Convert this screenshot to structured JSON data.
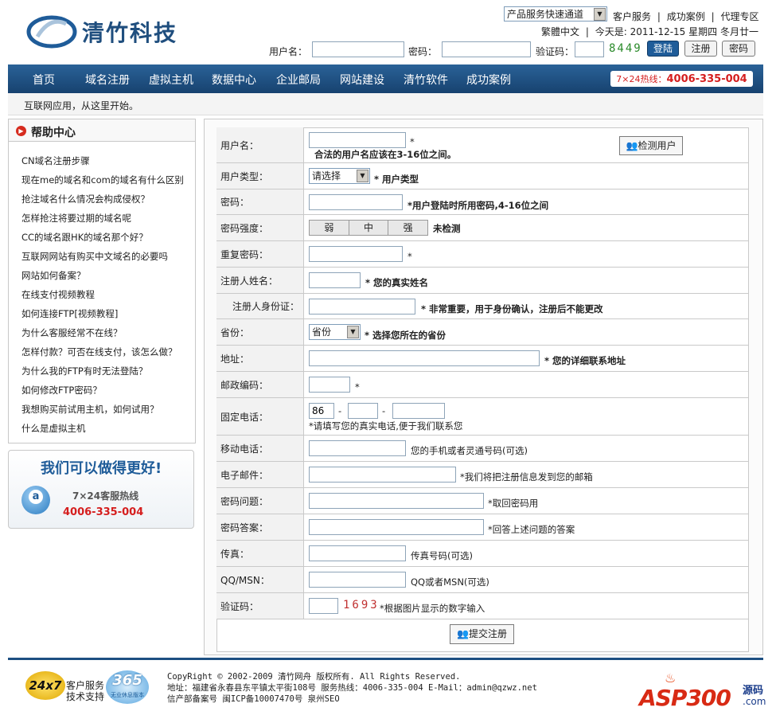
{
  "header": {
    "logo_text": "清竹科技",
    "quick_select": "产品服务快速通道",
    "top_links": [
      "客户服务",
      "成功案例",
      "代理专区"
    ],
    "lang_link": "繁體中文",
    "date_text": "今天是: 2011-12-15 星期四 冬月廿一",
    "username_label": "用户名：",
    "password_label": "密码：",
    "captcha_label": "验证码：",
    "captcha_code": "8449",
    "login_btn": "登陆",
    "register_btn": "注册",
    "password_btn": "密码"
  },
  "nav": {
    "items": [
      "首页",
      "域名注册",
      "虚拟主机",
      "数据中心",
      "企业邮局",
      "网站建设",
      "清竹软件",
      "成功案例"
    ],
    "hotline_prefix": "7×24热线：",
    "hotline_number": "4006-335-004"
  },
  "tagline": "互联网应用，从这里开始。",
  "help": {
    "title": "帮助中心",
    "links": [
      "CN域名注册步骤",
      "现在me的域名和com的域名有什么区别",
      "抢注域名什么情况会构成侵权？",
      "怎样抢注将要过期的域名呢",
      "CC的域名跟HK的域名那个好？",
      "互联网网站有购买中文域名的必要吗",
      "网站如何备案？",
      "在线支付视频教程",
      "如何连接FTP[视频教程]",
      "为什么客服经常不在线？",
      "怎样付款？可否在线支付，该怎么做？",
      "为什么我的FTP有时无法登陆？",
      "如何修改FTP密码？",
      "我想购买前试用主机，如何试用？",
      "什么是虚拟主机"
    ]
  },
  "service_box": {
    "slogan": "我们可以做得更好!",
    "line1": "7×24客服热线",
    "phone": "4006-335-004"
  },
  "form": {
    "username": {
      "label": "用户名：",
      "star": "*",
      "hint": "合法的用户名应该在3-16位之间。",
      "check_btn": "检测用户"
    },
    "user_type": {
      "label": "用户类型：",
      "select": "请选择",
      "hint": "* 用户类型"
    },
    "password": {
      "label": "密码：",
      "hint": "*用户登陆时所用密码,4-16位之间"
    },
    "strength": {
      "label": "密码强度：",
      "levels": [
        "弱",
        "中",
        "强"
      ],
      "status": "未检测"
    },
    "repeat": {
      "label": "重复密码：",
      "hint": "*"
    },
    "name": {
      "label": "注册人姓名：",
      "hint": "* 您的真实姓名"
    },
    "id_card": {
      "label": "注册人身份证：",
      "hint": "* 非常重要，用于身份确认，注册后不能更改"
    },
    "province": {
      "label": "省份：",
      "select": "省份",
      "hint": "* 选择您所在的省份"
    },
    "address": {
      "label": "地址：",
      "hint": "* 您的详细联系地址"
    },
    "zip": {
      "label": "邮政编码：",
      "hint": "*"
    },
    "phone": {
      "label": "固定电话：",
      "country": "86",
      "dash": "-",
      "hint": "*请填写您的真实电话,便于我们联系您"
    },
    "mobile": {
      "label": "移动电话：",
      "hint": "您的手机或者灵通号码(可选)"
    },
    "email": {
      "label": "电子邮件：",
      "hint": "*我们将把注册信息发到您的邮箱"
    },
    "question": {
      "label": "密码问题：",
      "hint": "*取回密码用"
    },
    "answer": {
      "label": "密码答案：",
      "hint": "*回答上述问题的答案"
    },
    "fax": {
      "label": "传真：",
      "hint": "传真号码(可选)"
    },
    "qq": {
      "label": "QQ/MSN：",
      "hint": "QQ或者MSN(可选)"
    },
    "captcha": {
      "label": "验证码：",
      "code": "1693",
      "hint": "*根据图片显示的数字输入"
    },
    "submit": "提交注册"
  },
  "footer": {
    "badge_247": "24x7",
    "service_line1": "客户服务",
    "service_line2": "技术支持",
    "badge_365": "365",
    "badge_365_sub": "无业休息版本",
    "copyright": "CopyRight © 2002-2009 清竹网舟 版权所有. All Rights Reserved.",
    "address": "地址：福建省永春县东平镇太平街108号 服务热线：4006-335-004 E-Mail：admin@qzwz.net",
    "icp": "信产部备案号 闽ICP备10007470号 泉州SEO",
    "logo_asp": "ASP300",
    "logo_src": "源码",
    "logo_com": ".com"
  },
  "colors": {
    "nav_bg": "#1d4f82",
    "hotline_red": "#d51e1e",
    "accent_blue": "#1f5c99"
  }
}
